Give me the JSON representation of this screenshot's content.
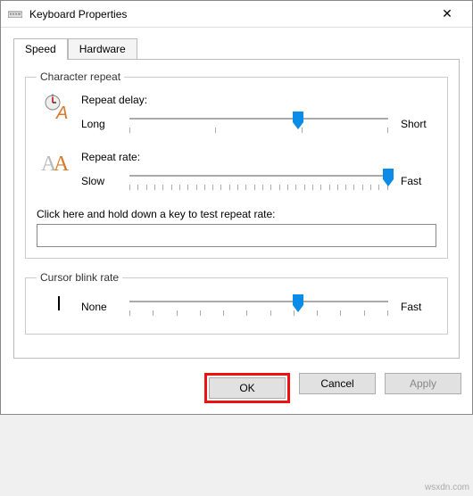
{
  "window": {
    "title": "Keyboard Properties",
    "close": "✕"
  },
  "tabs": {
    "speed": "Speed",
    "hardware": "Hardware"
  },
  "charRepeat": {
    "legend": "Character repeat",
    "delay": {
      "label": "Repeat delay:",
      "left": "Long",
      "right": "Short",
      "value": 65
    },
    "rate": {
      "label": "Repeat rate:",
      "left": "Slow",
      "right": "Fast",
      "value": 100
    },
    "testLabel": "Click here and hold down a key to test repeat rate:",
    "testValue": ""
  },
  "cursorBlink": {
    "legend": "Cursor blink rate",
    "left": "None",
    "right": "Fast",
    "value": 65
  },
  "buttons": {
    "ok": "OK",
    "cancel": "Cancel",
    "apply": "Apply"
  },
  "watermark": "wsxdn.com"
}
